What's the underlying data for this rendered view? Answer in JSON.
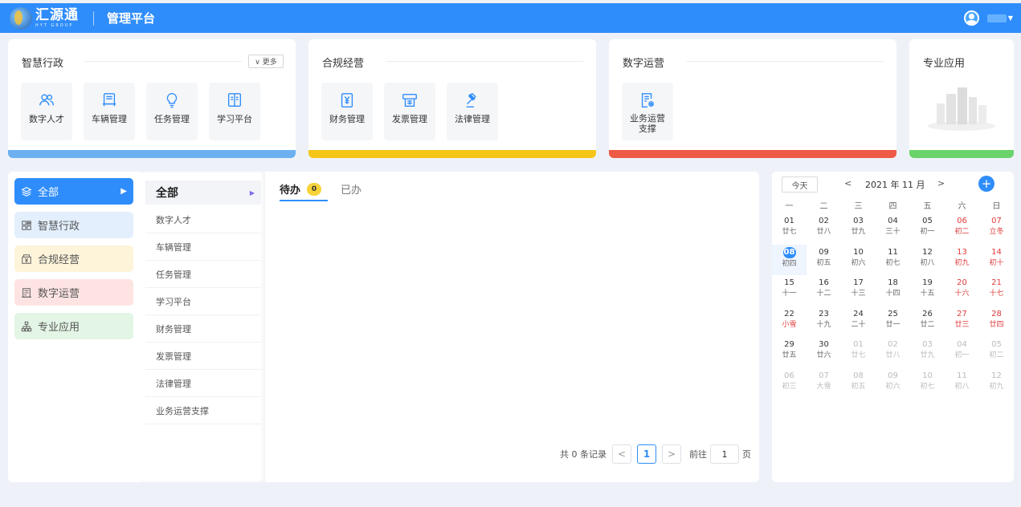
{
  "header": {
    "logo_name": "汇源通",
    "logo_sub": "HYT GROUP",
    "platform_title": "管理平台"
  },
  "categories": [
    {
      "title": "智慧行政",
      "more_label": "∨ 更多",
      "bar_color": "#6cb0f1",
      "tiles": [
        "数字人才",
        "车辆管理",
        "任务管理",
        "学习平台"
      ]
    },
    {
      "title": "合规经营",
      "bar_color": "#f5c518",
      "tiles": [
        "财务管理",
        "发票管理",
        "法律管理"
      ]
    },
    {
      "title": "数字运营",
      "bar_color": "#ee5a45",
      "tiles": [
        "业务运营\n支撑"
      ]
    },
    {
      "title": "专业应用",
      "bar_color": "#6bd36b"
    }
  ],
  "leftnav": {
    "items": [
      {
        "label": "全部",
        "bg": "#2f8dfb",
        "fg": "#ffffff",
        "arrow": "▶"
      },
      {
        "label": "智慧行政",
        "bg": "#e3effd",
        "fg": "#555555"
      },
      {
        "label": "合规经营",
        "bg": "#fdf4da",
        "fg": "#555555"
      },
      {
        "label": "数字运营",
        "bg": "#fde4e2",
        "fg": "#555555"
      },
      {
        "label": "专业应用",
        "bg": "#e3f5e5",
        "fg": "#555555"
      }
    ]
  },
  "submenu": {
    "head": "全部",
    "items": [
      "数字人才",
      "车辆管理",
      "任务管理",
      "学习平台",
      "财务管理",
      "发票管理",
      "法律管理",
      "业务运营支撑"
    ]
  },
  "tasks": {
    "tab_pending": "待办",
    "pending_count": "0",
    "tab_done": "已办",
    "pager": {
      "total_text": "共 0 条记录",
      "prev": "<",
      "current_page": "1",
      "next": ">",
      "goto_prefix": "前往",
      "goto_value": "1",
      "goto_suffix": "页"
    }
  },
  "calendar": {
    "today_label": "今天",
    "prev": "<",
    "next": ">",
    "month_label": "2021 年 11 月",
    "add": "+",
    "weekdays": [
      "一",
      "二",
      "三",
      "四",
      "五",
      "六",
      "日"
    ],
    "weeks": [
      [
        [
          "01",
          "廿七"
        ],
        [
          "02",
          "廿八"
        ],
        [
          "03",
          "廿九"
        ],
        [
          "04",
          "三十"
        ],
        [
          "05",
          "初一"
        ],
        [
          "06",
          "初二"
        ],
        [
          "07",
          "立冬"
        ]
      ],
      [
        [
          "08",
          "初四"
        ],
        [
          "09",
          "初五"
        ],
        [
          "10",
          "初六"
        ],
        [
          "11",
          "初七"
        ],
        [
          "12",
          "初八"
        ],
        [
          "13",
          "初九"
        ],
        [
          "14",
          "初十"
        ]
      ],
      [
        [
          "15",
          "十一"
        ],
        [
          "16",
          "十二"
        ],
        [
          "17",
          "十三"
        ],
        [
          "18",
          "十四"
        ],
        [
          "19",
          "十五"
        ],
        [
          "20",
          "十六"
        ],
        [
          "21",
          "十七"
        ]
      ],
      [
        [
          "22",
          "小雪"
        ],
        [
          "23",
          "十九"
        ],
        [
          "24",
          "二十"
        ],
        [
          "25",
          "廿一"
        ],
        [
          "26",
          "廿二"
        ],
        [
          "27",
          "廿三"
        ],
        [
          "28",
          "廿四"
        ]
      ],
      [
        [
          "29",
          "廿五"
        ],
        [
          "30",
          "廿六"
        ],
        [
          "01",
          "廿七"
        ],
        [
          "02",
          "廿八"
        ],
        [
          "03",
          "廿九"
        ],
        [
          "04",
          "初一"
        ],
        [
          "05",
          "初二"
        ]
      ],
      [
        [
          "06",
          "初三"
        ],
        [
          "07",
          "大雪"
        ],
        [
          "08",
          "初五"
        ],
        [
          "09",
          "初六"
        ],
        [
          "10",
          "初七"
        ],
        [
          "11",
          "初八"
        ],
        [
          "12",
          "初九"
        ]
      ]
    ]
  }
}
